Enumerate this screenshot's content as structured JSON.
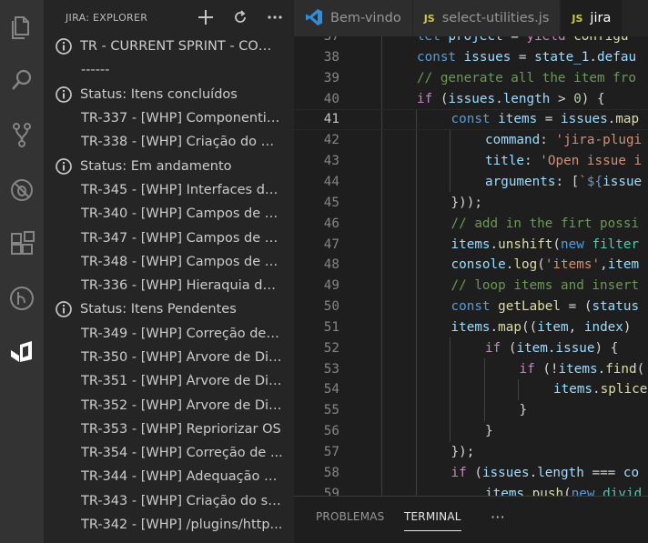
{
  "sidebar": {
    "title": "JIRA: EXPLORER",
    "actions": {
      "add": "add-icon",
      "refresh": "refresh-icon",
      "more": "more-icon"
    },
    "items": [
      {
        "kind": "top",
        "label": "TR - CURRENT SPRINT - COU...",
        "icon": "info-icon"
      },
      {
        "kind": "child",
        "label": "------"
      },
      {
        "kind": "top",
        "label": "Status: Itens concluídos",
        "icon": "info-icon"
      },
      {
        "kind": "child",
        "label": "TR-337 - [WHP] Componentiz..."
      },
      {
        "kind": "child",
        "label": "TR-338 - [WHP] Criação do Ba..."
      },
      {
        "kind": "top",
        "label": "Status: Em andamento",
        "icon": "info-icon"
      },
      {
        "kind": "child",
        "label": "TR-345 - [WHP] Interfaces de ..."
      },
      {
        "kind": "child",
        "label": "TR-340 - [WHP] Campos de c..."
      },
      {
        "kind": "child",
        "label": "TR-347 - [WHP] Campos de c..."
      },
      {
        "kind": "child",
        "label": "TR-348 - [WHP] Campos de c..."
      },
      {
        "kind": "child",
        "label": "TR-336 - [WHP] Hieraquia de ..."
      },
      {
        "kind": "top",
        "label": "Status: Itens Pendentes",
        "icon": "info-icon"
      },
      {
        "kind": "child",
        "label": "TR-349 - [WHP] Correção de e..."
      },
      {
        "kind": "child",
        "label": "TR-350 - [WHP] Árvore de Dia..."
      },
      {
        "kind": "child",
        "label": "TR-351 - [WHP] Árvore de Dia..."
      },
      {
        "kind": "child",
        "label": "TR-352 - [WHP] Árvore de Dia..."
      },
      {
        "kind": "child",
        "label": "TR-353 - [WHP] Repriorizar OS"
      },
      {
        "kind": "child",
        "label": "TR-354 - [WHP] Correção de ..."
      },
      {
        "kind": "child",
        "label": "TR-344 - [WHP] Adequação d..."
      },
      {
        "kind": "child",
        "label": "TR-343 - [WHP] Criação do se..."
      },
      {
        "kind": "child",
        "label": "TR-342 - [WHP] /plugins/http..."
      }
    ]
  },
  "tabs": [
    {
      "label": "Bem-vindo",
      "icon": "vscode-icon",
      "active": false
    },
    {
      "label": "select-utilities.js",
      "icon": "js-icon",
      "badge": "JS",
      "active": false
    },
    {
      "label": "jira",
      "icon": "js-icon",
      "badge": "JS",
      "active": true
    }
  ],
  "editor": {
    "current_line": "41",
    "lines": [
      {
        "n": "37",
        "indent": 2,
        "tokens": [
          [
            "kw",
            "let "
          ],
          [
            "var",
            "project"
          ],
          [
            "pl",
            " = "
          ],
          [
            "ctl",
            "yield "
          ],
          [
            "fn",
            "configu"
          ]
        ]
      },
      {
        "n": "38",
        "indent": 2,
        "tokens": [
          [
            "kw",
            "const "
          ],
          [
            "var",
            "issues"
          ],
          [
            "pl",
            " = "
          ],
          [
            "var",
            "state_1"
          ],
          [
            "pl",
            "."
          ],
          [
            "var",
            "defau"
          ]
        ]
      },
      {
        "n": "39",
        "indent": 2,
        "tokens": [
          [
            "cmt",
            "// generate all the item fro"
          ]
        ]
      },
      {
        "n": "40",
        "indent": 2,
        "tokens": [
          [
            "ctl",
            "if "
          ],
          [
            "pl",
            "("
          ],
          [
            "var",
            "issues"
          ],
          [
            "pl",
            "."
          ],
          [
            "var",
            "length"
          ],
          [
            "pl",
            " > "
          ],
          [
            "num",
            "0"
          ],
          [
            "pl",
            ") {"
          ]
        ]
      },
      {
        "n": "41",
        "indent": 3,
        "tokens": [
          [
            "kw",
            "const "
          ],
          [
            "var",
            "items"
          ],
          [
            "pl",
            " = "
          ],
          [
            "var",
            "issues"
          ],
          [
            "pl",
            "."
          ],
          [
            "fn",
            "map"
          ]
        ]
      },
      {
        "n": "42",
        "indent": 4,
        "tokens": [
          [
            "var",
            "command"
          ],
          [
            "pl",
            ": "
          ],
          [
            "str",
            "'jira-plugi"
          ]
        ]
      },
      {
        "n": "43",
        "indent": 4,
        "tokens": [
          [
            "var",
            "title"
          ],
          [
            "pl",
            ": "
          ],
          [
            "str",
            "'Open issue i"
          ]
        ]
      },
      {
        "n": "44",
        "indent": 4,
        "tokens": [
          [
            "var",
            "arguments"
          ],
          [
            "pl",
            ": ["
          ],
          [
            "str",
            "`"
          ],
          [
            "kw",
            "${"
          ],
          [
            "var",
            "issue"
          ]
        ]
      },
      {
        "n": "45",
        "indent": 3,
        "tokens": [
          [
            "pl",
            "}));"
          ]
        ]
      },
      {
        "n": "46",
        "indent": 3,
        "tokens": [
          [
            "cmt",
            "// add in the firt possi"
          ]
        ]
      },
      {
        "n": "47",
        "indent": 3,
        "tokens": [
          [
            "var",
            "items"
          ],
          [
            "pl",
            "."
          ],
          [
            "fn",
            "unshift"
          ],
          [
            "pl",
            "("
          ],
          [
            "kw",
            "new "
          ],
          [
            "cls",
            "filter"
          ]
        ]
      },
      {
        "n": "48",
        "indent": 3,
        "tokens": [
          [
            "var",
            "console"
          ],
          [
            "pl",
            "."
          ],
          [
            "fn",
            "log"
          ],
          [
            "pl",
            "("
          ],
          [
            "str",
            "'items'"
          ],
          [
            "pl",
            ","
          ],
          [
            "var",
            "item"
          ]
        ]
      },
      {
        "n": "49",
        "indent": 3,
        "tokens": [
          [
            "cmt",
            "// loop items and insert"
          ]
        ]
      },
      {
        "n": "50",
        "indent": 3,
        "tokens": [
          [
            "kw",
            "const "
          ],
          [
            "fn",
            "getLabel"
          ],
          [
            "pl",
            " = ("
          ],
          [
            "var",
            "status"
          ]
        ]
      },
      {
        "n": "51",
        "indent": 3,
        "tokens": [
          [
            "var",
            "items"
          ],
          [
            "pl",
            "."
          ],
          [
            "fn",
            "map"
          ],
          [
            "pl",
            "(("
          ],
          [
            "var",
            "item"
          ],
          [
            "pl",
            ", "
          ],
          [
            "var",
            "index"
          ],
          [
            "pl",
            ")"
          ]
        ]
      },
      {
        "n": "52",
        "indent": 4,
        "tokens": [
          [
            "ctl",
            "if "
          ],
          [
            "pl",
            "("
          ],
          [
            "var",
            "item"
          ],
          [
            "pl",
            "."
          ],
          [
            "var",
            "issue"
          ],
          [
            "pl",
            ") {"
          ]
        ]
      },
      {
        "n": "53",
        "indent": 5,
        "tokens": [
          [
            "ctl",
            "if "
          ],
          [
            "pl",
            "(!"
          ],
          [
            "var",
            "items"
          ],
          [
            "pl",
            "."
          ],
          [
            "fn",
            "find"
          ],
          [
            "pl",
            "("
          ]
        ]
      },
      {
        "n": "54",
        "indent": 6,
        "tokens": [
          [
            "var",
            "items"
          ],
          [
            "pl",
            "."
          ],
          [
            "fn",
            "splice"
          ]
        ]
      },
      {
        "n": "55",
        "indent": 5,
        "tokens": [
          [
            "pl",
            "}"
          ]
        ]
      },
      {
        "n": "56",
        "indent": 4,
        "tokens": [
          [
            "pl",
            "}"
          ]
        ]
      },
      {
        "n": "57",
        "indent": 3,
        "tokens": [
          [
            "pl",
            "});"
          ]
        ]
      },
      {
        "n": "58",
        "indent": 3,
        "tokens": [
          [
            "ctl",
            "if "
          ],
          [
            "pl",
            "("
          ],
          [
            "var",
            "issues"
          ],
          [
            "pl",
            "."
          ],
          [
            "var",
            "length"
          ],
          [
            "pl",
            " === "
          ],
          [
            "var",
            "co"
          ]
        ]
      },
      {
        "n": "59",
        "indent": 4,
        "tokens": [
          [
            "var",
            "items"
          ],
          [
            "pl",
            "."
          ],
          [
            "fn",
            "push"
          ],
          [
            "pl",
            "("
          ],
          [
            "kw",
            "new "
          ],
          [
            "cls",
            "divid"
          ]
        ]
      }
    ]
  },
  "panel": {
    "tabs": [
      {
        "label": "PROBLEMAS",
        "active": false
      },
      {
        "label": "TERMINAL",
        "active": true
      },
      {
        "label": "···",
        "active": false
      }
    ]
  }
}
